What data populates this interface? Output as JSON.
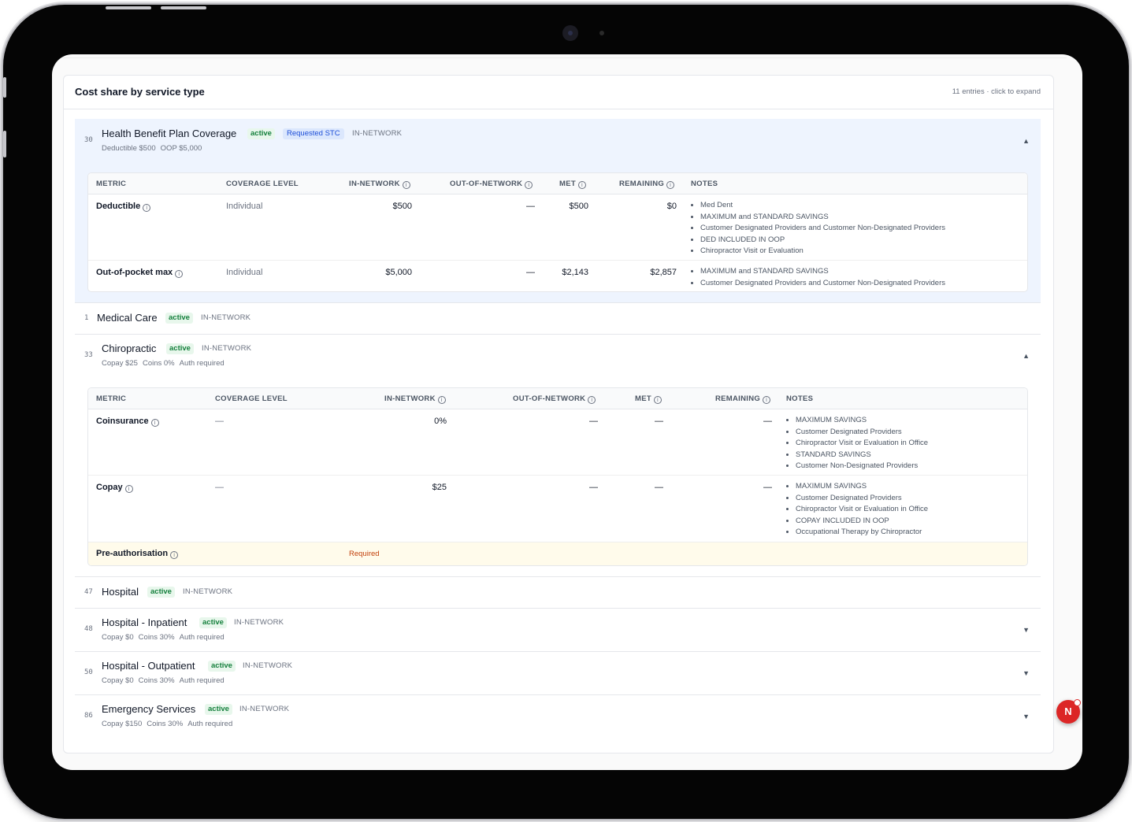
{
  "card": {
    "title": "Cost share by service type",
    "hint": "11 entries · click to expand"
  },
  "columns_a": {
    "metric": "METRIC",
    "coverage": "COVERAGE LEVEL",
    "in_network": "IN-NETWORK",
    "out_network": "OUT-OF-NETWORK",
    "met": "MET",
    "remaining": "REMAINING",
    "notes": "NOTES"
  },
  "entries": [
    {
      "num": "30",
      "name": "Health Benefit Plan Coverage",
      "status": "active",
      "requested": "Requested STC",
      "network": "IN-NETWORK",
      "summary": [
        "Deductible $500",
        "OOP $5,000"
      ],
      "chevron": "▲",
      "rows": [
        {
          "metric": "Deductible",
          "coverage": "Individual",
          "in_network": "$500",
          "out_network": "—",
          "met": "$500",
          "remaining": "$0",
          "notes": [
            "Med Dent",
            "MAXIMUM and STANDARD SAVINGS",
            "Customer Designated Providers and Customer Non-Designated Providers",
            "DED INCLUDED IN OOP",
            "Chiropractor Visit or Evaluation"
          ]
        },
        {
          "metric": "Out-of-pocket max",
          "coverage": "Individual",
          "in_network": "$5,000",
          "out_network": "—",
          "met": "$2,143",
          "remaining": "$2,857",
          "notes": [
            "MAXIMUM and STANDARD SAVINGS",
            "Customer Designated Providers and Customer Non-Designated Providers"
          ]
        }
      ]
    },
    {
      "num": "1",
      "name": "Medical Care",
      "status": "active",
      "network": "IN-NETWORK"
    },
    {
      "num": "33",
      "name": "Chiropractic",
      "status": "active",
      "network": "IN-NETWORK",
      "summary": [
        "Copay $25",
        "Coins 0%",
        "Auth required"
      ],
      "chevron": "▲",
      "rows": [
        {
          "metric": "Coinsurance",
          "coverage": "—",
          "in_network": "0%",
          "out_network": "—",
          "met": "—",
          "remaining": "—",
          "notes": [
            "MAXIMUM SAVINGS",
            "Customer Designated Providers",
            "Chiropractor Visit or Evaluation in Office",
            "STANDARD SAVINGS",
            "Customer Non-Designated Providers"
          ]
        },
        {
          "metric": "Copay",
          "coverage": "—",
          "in_network": "$25",
          "out_network": "—",
          "met": "—",
          "remaining": "—",
          "notes": [
            "MAXIMUM SAVINGS",
            "Customer Designated Providers",
            "Chiropractor Visit or Evaluation in Office",
            "COPAY INCLUDED IN OOP",
            "Occupational Therapy by Chiropractor"
          ]
        }
      ],
      "preauth": {
        "metric": "Pre-authorisation",
        "value": "Required"
      }
    },
    {
      "num": "47",
      "name": "Hospital",
      "status": "active",
      "network": "IN-NETWORK"
    },
    {
      "num": "48",
      "name": "Hospital - Inpatient",
      "status": "active",
      "network": "IN-NETWORK",
      "summary": [
        "Copay $0",
        "Coins 30%",
        "Auth required"
      ],
      "chevron": "▼"
    },
    {
      "num": "50",
      "name": "Hospital - Outpatient",
      "status": "active",
      "network": "IN-NETWORK",
      "summary": [
        "Copay $0",
        "Coins 30%",
        "Auth required"
      ],
      "chevron": "▼"
    },
    {
      "num": "86",
      "name": "Emergency Services",
      "status": "active",
      "network": "IN-NETWORK",
      "summary": [
        "Copay $150",
        "Coins 30%",
        "Auth required"
      ],
      "chevron": "▼"
    }
  ],
  "fab": {
    "label": "N"
  },
  "colors": {
    "active": "#15803d",
    "requested": "#1d4ed8",
    "required": "#c2410c",
    "expanded_bg": "#eef4fe",
    "fab": "#dc2626"
  },
  "icons": {
    "info": "info-icon",
    "expanded": "chevron-up-icon",
    "collapsed": "chevron-down-icon"
  }
}
